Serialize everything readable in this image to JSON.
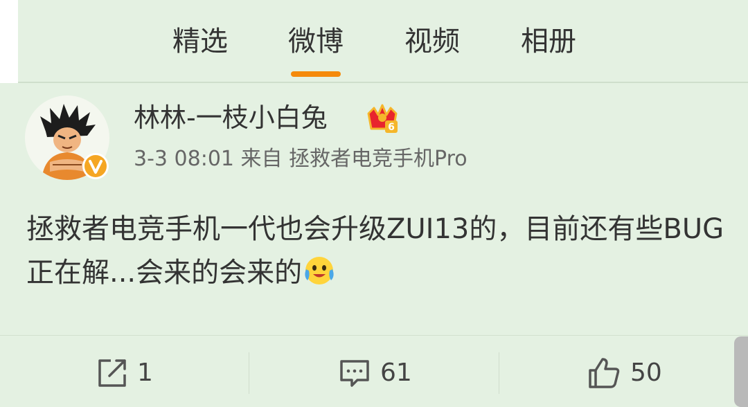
{
  "tabs": [
    {
      "label": "精选",
      "active": false
    },
    {
      "label": "微博",
      "active": true
    },
    {
      "label": "视频",
      "active": false
    },
    {
      "label": "相册",
      "active": false
    }
  ],
  "post": {
    "username": "林林-一枝小白兔",
    "member_level": "6",
    "meta": "3-3 08:01 来自 拯救者电竞手机Pro",
    "text": "拯救者电竞手机一代也会升级ZUI13的，目前还有些BUG正在解...会来的会来的",
    "emoji": "smiling-tears-emoji"
  },
  "actions": {
    "repost": {
      "icon": "repost-icon",
      "count": "1"
    },
    "comment": {
      "icon": "comment-icon",
      "count": "61"
    },
    "like": {
      "icon": "thumbs-up-icon",
      "count": "50"
    }
  },
  "colors": {
    "background": "#e4f1e2",
    "accent": "#f58a0b",
    "verified": "#f5a623"
  }
}
